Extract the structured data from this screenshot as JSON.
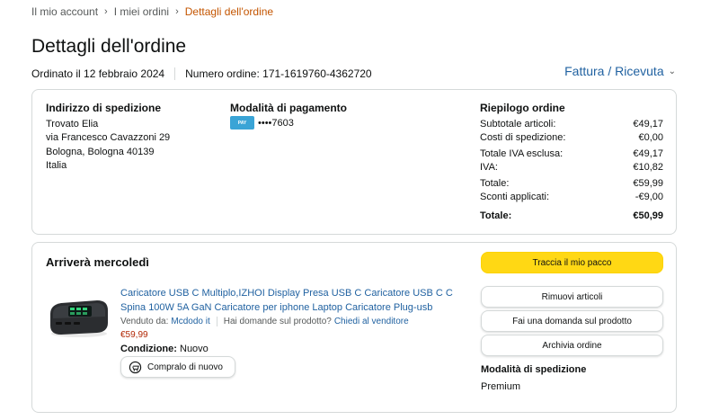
{
  "breadcrumb": {
    "items": [
      "Il mio account",
      "I miei ordini"
    ],
    "current": "Dettagli dell'ordine"
  },
  "page_title": "Dettagli dell'ordine",
  "order_meta": {
    "ordered": "Ordinato il 12 febbraio 2024",
    "number": "Numero ordine: 171-1619760-4362720"
  },
  "invoice_link": "Fattura / Ricevuta",
  "shipping_address": {
    "title": "Indirizzo di spedizione",
    "lines": [
      "Trovato Elia",
      "via Francesco Cavazzoni 29",
      "Bologna, Bologna 40139",
      "Italia"
    ]
  },
  "payment": {
    "title": "Modalità di pagamento",
    "card_brand": "PAY",
    "card_number": "••••7603"
  },
  "summary": {
    "title": "Riepilogo ordine",
    "rows": [
      {
        "label": "Subtotale articoli:",
        "value": "€49,17"
      },
      {
        "label": "Costi di spedizione:",
        "value": "€0,00"
      },
      {
        "label": "Totale IVA esclusa:",
        "value": "€49,17"
      },
      {
        "label": "IVA:",
        "value": "€10,82"
      },
      {
        "label": "Totale:",
        "value": "€59,99"
      },
      {
        "label": "Sconti applicati:",
        "value": "-€9,00"
      }
    ],
    "total_label": "Totale:",
    "total_value": "€50,99"
  },
  "delivery": {
    "arrival": "Arriverà mercoledì",
    "product_title": "Caricatore USB C Multiplo,IZHOI Display Presa USB C Caricatore USB C C Spina 100W 5A GaN Caricatore per iphone Laptop Caricatore Plug-usb",
    "sold_by_label": "Venduto da:",
    "seller": "Mcdodo it",
    "question": "Hai domande sul prodotto?",
    "contact_seller": "Chiedi al venditore",
    "price": "€59,99",
    "condition_label": "Condizione:",
    "condition_value": "Nuovo",
    "buy_again": "Compralo di nuovo"
  },
  "actions": {
    "track": "Traccia il mio pacco",
    "return": "Rimuovi articoli",
    "ask": "Fai una domanda sul prodotto",
    "archive": "Archivia ordine"
  },
  "shipping_method": {
    "title": "Modalità di spedizione",
    "value": "Premium"
  },
  "colors": {
    "link": "#2162a1",
    "breadcrumb_current": "#c45500",
    "primary_button": "#ffd814",
    "price": "#b12704",
    "border": "#d5d9d9"
  }
}
